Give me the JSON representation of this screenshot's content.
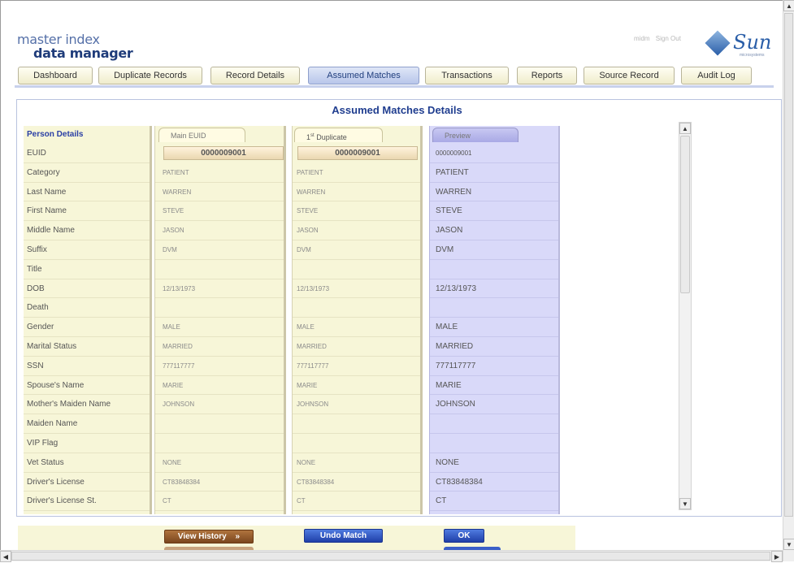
{
  "header": {
    "logo_line1": "master index",
    "logo_line2": "data manager",
    "user": "midm",
    "sign_out": "Sign Out",
    "brand": "Sun",
    "brand_sub": "microsystems"
  },
  "tabs": [
    {
      "label": "Dashboard"
    },
    {
      "label": "Duplicate Records"
    },
    {
      "label": "Record Details"
    },
    {
      "label": "Assumed Matches",
      "active": true
    },
    {
      "label": "Transactions"
    },
    {
      "label": "Reports"
    },
    {
      "label": "Source Record"
    },
    {
      "label": "Audit Log"
    }
  ],
  "page_title": "Assumed Matches Details",
  "columns": {
    "labels_header": "Person Details",
    "main_tab": "Main EUID",
    "dup_tab_num": "1",
    "dup_tab_sup": "st",
    "dup_tab_rest": " Duplicate",
    "preview_tab": "Preview",
    "main_euid": "0000009001",
    "dup_euid": "0000009001"
  },
  "fields": [
    {
      "label": "EUID",
      "main": "",
      "dup": "",
      "preview": "0000009001"
    },
    {
      "label": "Category",
      "main": "PATIENT",
      "dup": "PATIENT",
      "preview": "PATIENT"
    },
    {
      "label": "Last Name",
      "main": "WARREN",
      "dup": "WARREN",
      "preview": "WARREN"
    },
    {
      "label": "First Name",
      "main": "STEVE",
      "dup": "STEVE",
      "preview": "STEVE"
    },
    {
      "label": "Middle Name",
      "main": "JASON",
      "dup": "JASON",
      "preview": "JASON"
    },
    {
      "label": "Suffix",
      "main": "DVM",
      "dup": "DVM",
      "preview": "DVM"
    },
    {
      "label": "Title",
      "main": "",
      "dup": "",
      "preview": ""
    },
    {
      "label": "DOB",
      "main": "12/13/1973",
      "dup": "12/13/1973",
      "preview": "12/13/1973"
    },
    {
      "label": "Death",
      "main": "",
      "dup": "",
      "preview": ""
    },
    {
      "label": "Gender",
      "main": "MALE",
      "dup": "MALE",
      "preview": "MALE"
    },
    {
      "label": "Marital Status",
      "main": "MARRIED",
      "dup": "MARRIED",
      "preview": "MARRIED"
    },
    {
      "label": "SSN",
      "main": "777117777",
      "dup": "777117777",
      "preview": "777117777"
    },
    {
      "label": "Spouse's Name",
      "main": "MARIE",
      "dup": "MARIE",
      "preview": "MARIE"
    },
    {
      "label": "Mother's Maiden Name",
      "main": "JOHNSON",
      "dup": "JOHNSON",
      "preview": "JOHNSON"
    },
    {
      "label": "Maiden Name",
      "main": "",
      "dup": "",
      "preview": ""
    },
    {
      "label": "VIP Flag",
      "main": "",
      "dup": "",
      "preview": ""
    },
    {
      "label": "Vet Status",
      "main": "NONE",
      "dup": "NONE",
      "preview": "NONE"
    },
    {
      "label": "Driver's License",
      "main": "CT83848384",
      "dup": "CT83848384",
      "preview": "CT83848384"
    },
    {
      "label": "Driver's License St.",
      "main": "CT",
      "dup": "CT",
      "preview": "CT"
    }
  ],
  "buttons": {
    "view_history": "View History",
    "view_history_icon": "double-chevron-right",
    "undo_match": "Undo Match",
    "ok": "OK"
  },
  "colors": {
    "accent": "#1f3d8f",
    "column_bg": "#f7f6d8",
    "preview_bg": "#d9d9f9",
    "history_btn": "#8a5228",
    "action_btn": "#2b4fc0"
  }
}
